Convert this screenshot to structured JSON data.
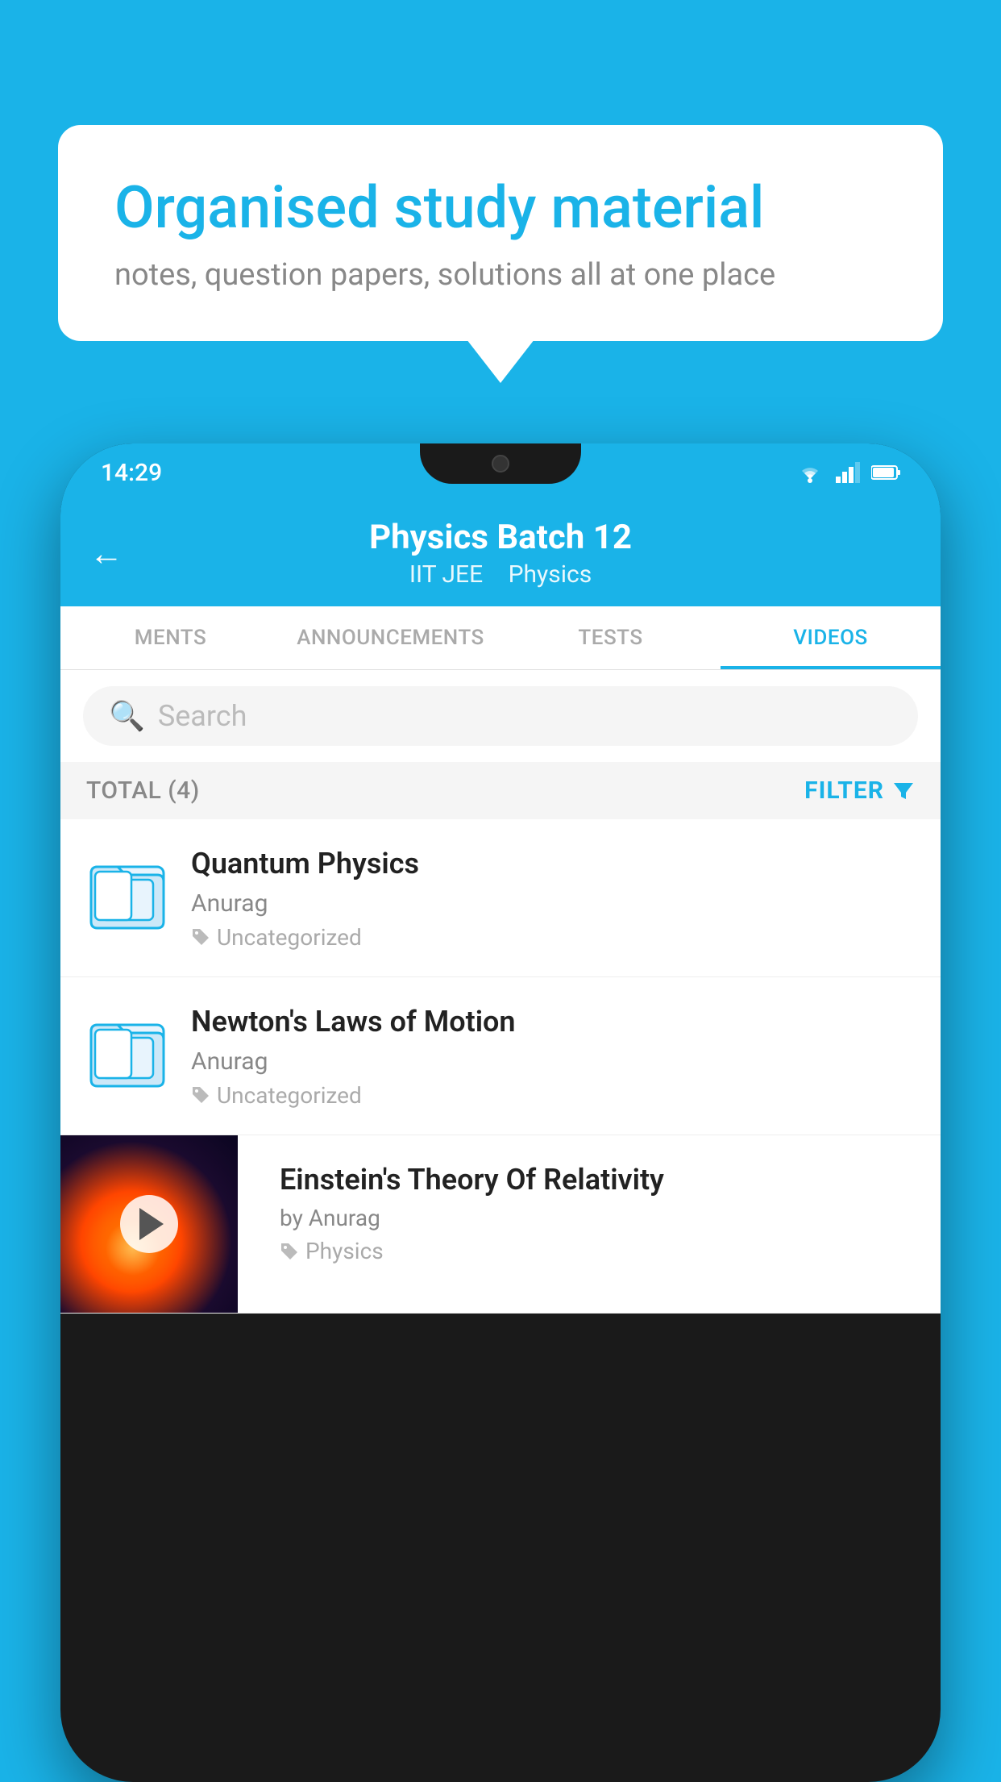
{
  "background_color": "#1ab3e8",
  "bubble": {
    "title": "Organised study material",
    "subtitle": "notes, question papers, solutions all at one place"
  },
  "phone": {
    "status_bar": {
      "time": "14:29",
      "icons": [
        "wifi",
        "signal",
        "battery"
      ]
    },
    "header": {
      "back_label": "←",
      "title": "Physics Batch 12",
      "subtitle_part1": "IIT JEE",
      "subtitle_part2": "Physics"
    },
    "tabs": [
      {
        "label": "MENTS",
        "active": false
      },
      {
        "label": "ANNOUNCEMENTS",
        "active": false
      },
      {
        "label": "TESTS",
        "active": false
      },
      {
        "label": "VIDEOS",
        "active": true
      }
    ],
    "search": {
      "placeholder": "Search"
    },
    "filter_bar": {
      "total_label": "TOTAL (4)",
      "filter_label": "FILTER"
    },
    "videos": [
      {
        "id": "quantum",
        "title": "Quantum Physics",
        "author": "Anurag",
        "tag": "Uncategorized",
        "has_thumb": false
      },
      {
        "id": "newton",
        "title": "Newton's Laws of Motion",
        "author": "Anurag",
        "tag": "Uncategorized",
        "has_thumb": false
      },
      {
        "id": "einstein",
        "title": "Einstein's Theory Of Relativity",
        "author": "by Anurag",
        "tag": "Physics",
        "has_thumb": true
      }
    ]
  }
}
